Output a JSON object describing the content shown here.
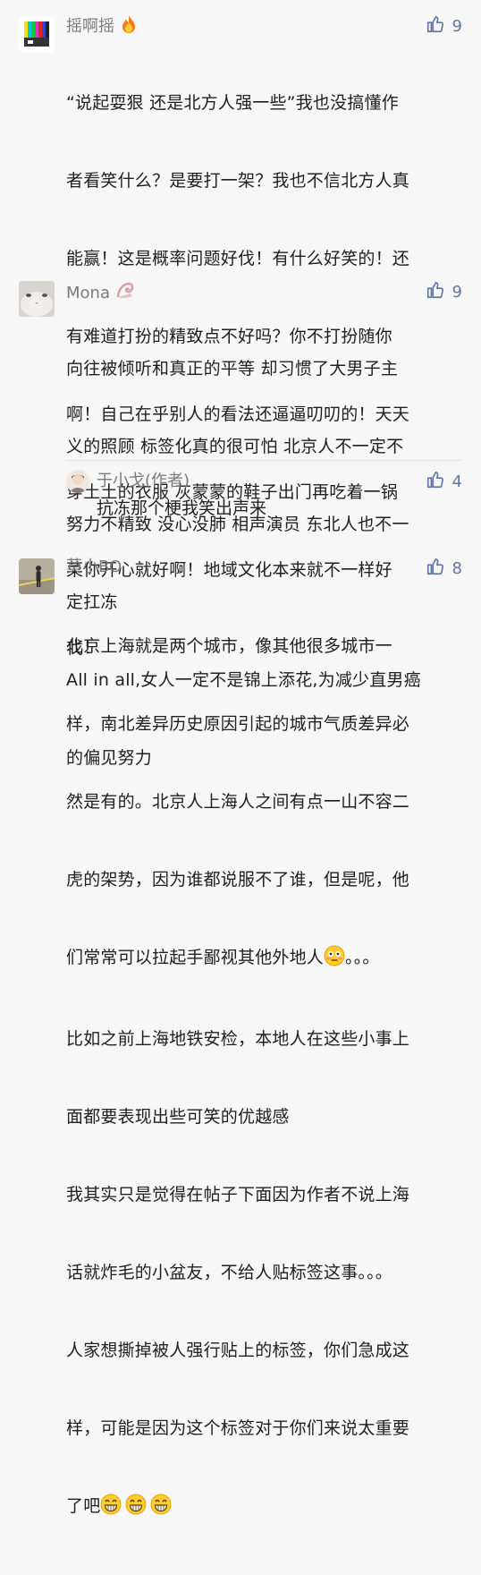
{
  "comments": [
    {
      "name": "摇啊摇",
      "name_icon": "fire-icon",
      "likes": "9",
      "lines": [
        "“说起耍狠 还是北方人强一些”我也没搞懂作",
        "者看笑什么？是要打一架？我也不信北方人真",
        "能赢！这是概率问题好伐！有什么好笑的！还",
        "有难道打扮的精致点不好吗？你不打扮随你",
        "啊！自己在乎别人的看法还逼逼叨叨的！天天",
        "穿土土的衣服 灰蒙蒙的鞋子出门再吃着一锅",
        "菜你开心就好啊！地域文化本来就不一样好",
        "伐！"
      ]
    },
    {
      "name": "Mona",
      "name_icon": "shell-icon",
      "likes": "9",
      "lines": [
        "向往被倾听和真正的平等 却习惯了大男子主",
        "义的照顾 标签化真的很可怕 北京人不一定不",
        "努力不精致 没心没肺 相声演员 东北人也不一",
        "定扛冻",
        "All in all,女人一定不是锦上添花,为减少直男癌",
        "的偏见努力"
      ],
      "reply": {
        "name": "于小戈(作者)",
        "likes": "4",
        "text": "抗冻那个梗我笑出声来"
      }
    },
    {
      "name": "莫小BO",
      "likes": "8",
      "lines": [
        "北京上海就是两个城市，像其他很多城市一",
        "样，南北差异历史原因引起的城市气质差异必",
        "然是有的。北京人上海人之间有点一山不容二",
        "虎的架势，因为谁都说服不了谁，但是呢，他",
        "们常常可以拉起手鄙视其他外地人",
        "比如之前上海地铁安检，本地人在这些小事上",
        "面都要表现出些可笑的优越感",
        "我其实只是觉得在帖子下面因为作者不说上海",
        "话就炸毛的小盆友，不给人贴标签这事。。。",
        "人家想撕掉被人强行贴上的标签，你们急成这",
        "样，可能是因为这个标签对于你们来说太重要",
        "了吧"
      ],
      "line5_suffix": "。。。",
      "emojis": [
        "flushed-face-icon",
        "grinning-face-icon"
      ]
    }
  ],
  "colors": {
    "background": "#f7f7f7",
    "name": "#7b7b7b",
    "like": "#5f77a3",
    "text": "#1f1f1f"
  }
}
